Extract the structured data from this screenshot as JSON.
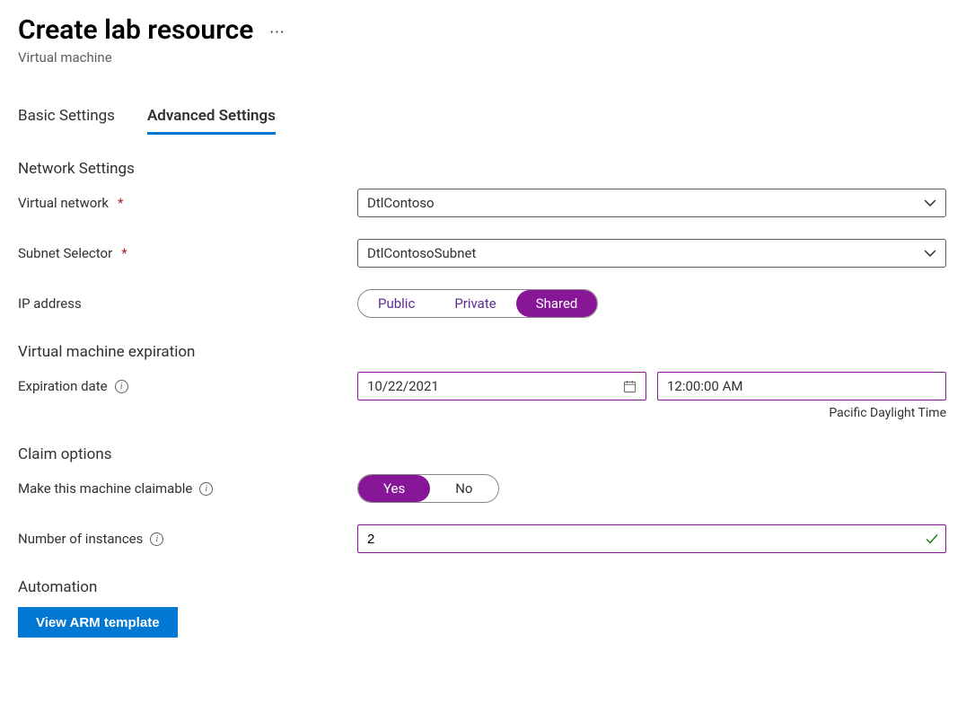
{
  "header": {
    "title": "Create lab resource",
    "subtitle": "Virtual machine"
  },
  "tabs": {
    "basic": "Basic Settings",
    "advanced": "Advanced Settings"
  },
  "sections": {
    "network": "Network Settings",
    "expiration": "Virtual machine expiration",
    "claim": "Claim options",
    "automation": "Automation"
  },
  "network": {
    "vnet_label": "Virtual network",
    "vnet_value": "DtlContoso",
    "subnet_label": "Subnet Selector",
    "subnet_value": "DtlContosoSubnet",
    "ip_label": "IP address",
    "ip_options": {
      "public": "Public",
      "private": "Private",
      "shared": "Shared"
    }
  },
  "expiration": {
    "date_label": "Expiration date",
    "date_value": "10/22/2021",
    "time_value": "12:00:00 AM",
    "tz": "Pacific Daylight Time"
  },
  "claim": {
    "label": "Make this machine claimable",
    "yes": "Yes",
    "no": "No",
    "instances_label": "Number of instances",
    "instances_value": "2"
  },
  "automation": {
    "button": "View ARM template"
  }
}
